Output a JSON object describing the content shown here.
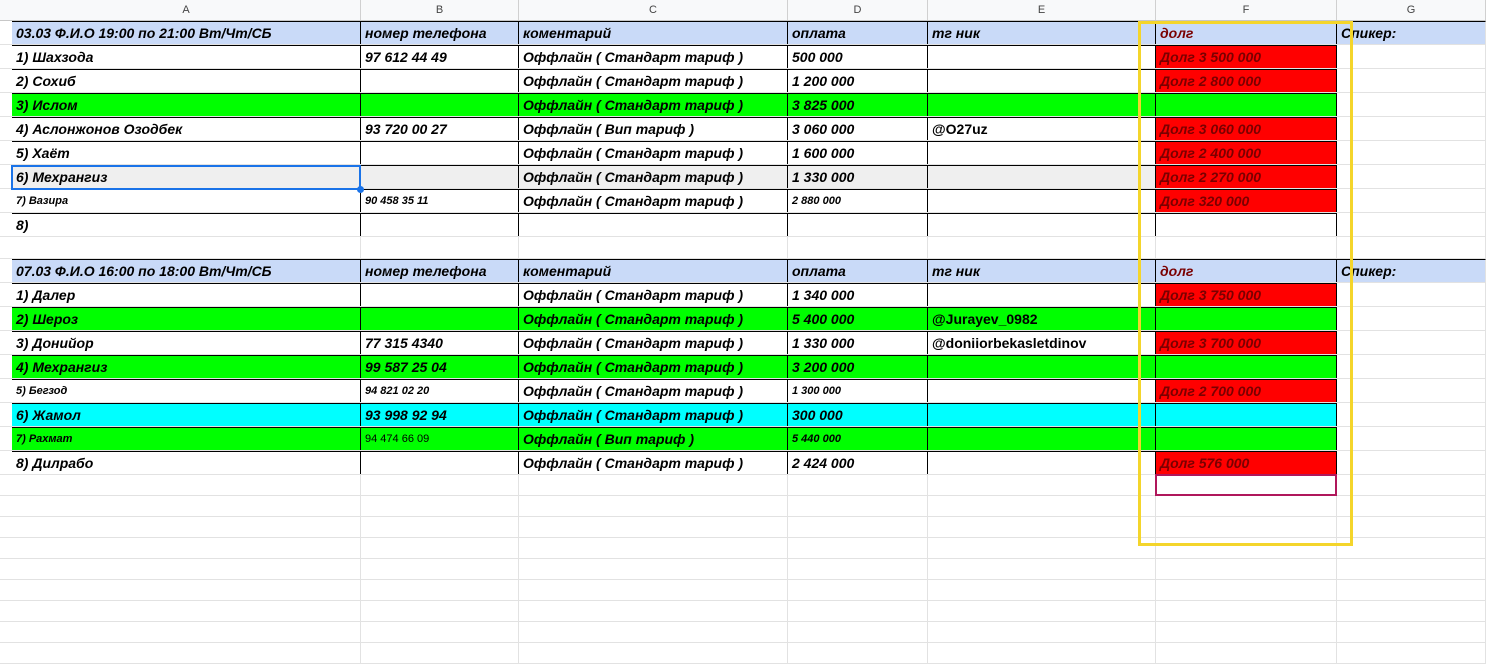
{
  "columns": [
    "A",
    "B",
    "C",
    "D",
    "E",
    "F",
    "G"
  ],
  "colors": {
    "header": "#c9daf8",
    "green": "#00ff00",
    "red": "#ff0000",
    "cyan": "#00ffff",
    "selected": "#efefef",
    "highlight_box": "#f4d52b",
    "selection": "#1a73e8"
  },
  "section1": {
    "header": [
      "03.03  Ф.И.О 19:00 по 21:00 Вт/Чт/СБ",
      "номер телефона",
      "коментарий",
      "оплата",
      "тг ник",
      "долг",
      "Спикер:"
    ],
    "rows": [
      {
        "fill": "",
        "cells": [
          "1) Шахзода",
          "97 612 44 49",
          "Оффлайн ( Стандарт тариф )",
          "500 000",
          "",
          "Долг 3 500 000",
          ""
        ],
        "debt_fill": "red"
      },
      {
        "fill": "",
        "cells": [
          "2) Сохиб",
          "",
          "Оффлайн ( Стандарт тариф )",
          "1 200 000",
          "",
          "Долг 2 800 000",
          ""
        ],
        "debt_fill": "red"
      },
      {
        "fill": "green",
        "cells": [
          "3) Ислом",
          "",
          "Оффлайн ( Стандарт тариф )",
          "3 825 000",
          "",
          "",
          ""
        ],
        "debt_fill": "green"
      },
      {
        "fill": "",
        "cells": [
          "4) Аслонжонов Озодбек",
          "93 720 00 27",
          "Оффлайн ( Вип тариф )",
          "3 060 000",
          "@O27uz",
          "Долг 3 060 000",
          ""
        ],
        "debt_fill": "red"
      },
      {
        "fill": "",
        "cells": [
          "5) Хаёт",
          "",
          "Оффлайн ( Стандарт тариф )",
          "1 600 000",
          "",
          "Долг 2 400 000",
          ""
        ],
        "debt_fill": "red"
      },
      {
        "fill": "selected",
        "cells": [
          "6) Мехрангиз",
          "",
          "Оффлайн ( Стандарт тариф )",
          "1 330 000",
          "",
          "Долг 2 270 000",
          ""
        ],
        "debt_fill": "red"
      },
      {
        "fill": "",
        "small": true,
        "cells": [
          "7) Вазира",
          "90 458 35 11",
          "Оффлайн ( Стандарт тариф )",
          "2 880 000",
          "",
          "Долг 320 000",
          ""
        ],
        "debt_fill": "red"
      },
      {
        "fill": "",
        "cells": [
          "8)",
          "",
          "",
          "",
          "",
          "",
          ""
        ],
        "debt_fill": ""
      }
    ]
  },
  "section2": {
    "header": [
      "07.03  Ф.И.О 16:00 по 18:00 Вт/Чт/СБ",
      "номер телефона",
      "коментарий",
      "оплата",
      "тг ник",
      "долг",
      "Спикер:"
    ],
    "rows": [
      {
        "fill": "",
        "cells": [
          "1) Далер",
          "",
          "Оффлайн ( Стандарт тариф )",
          "1 340 000",
          "",
          "Долг 3 750 000",
          ""
        ],
        "debt_fill": "red"
      },
      {
        "fill": "green",
        "cells": [
          "2) Шероз",
          "",
          "Оффлайн ( Стандарт тариф )",
          "5 400 000",
          "@Jurayev_0982",
          "",
          ""
        ],
        "debt_fill": "green"
      },
      {
        "fill": "",
        "cells": [
          "3) Донийор",
          "77 315 4340",
          "Оффлайн ( Стандарт тариф )",
          "1 330 000",
          "@doniiorbekasletdinov",
          "Долг 3 700 000",
          ""
        ],
        "debt_fill": "red"
      },
      {
        "fill": "green",
        "cells": [
          "4) Мехрангиз",
          "99 587 25 04",
          "Оффлайн ( Стандарт тариф )",
          "3 200 000",
          "",
          "",
          ""
        ],
        "debt_fill": "green"
      },
      {
        "fill": "",
        "small": true,
        "cells": [
          "5) Бегзод",
          "94 821 02 20",
          "Оффлайн ( Стандарт тариф )",
          "1 300 000",
          "",
          "Долг 2 700 000",
          ""
        ],
        "debt_fill": "red"
      },
      {
        "fill": "cyan",
        "cells": [
          "6) Жамол",
          "93 998 92 94",
          "Оффлайн ( Стандарт тариф )",
          "300 000",
          "",
          "",
          ""
        ],
        "debt_fill": "cyan"
      },
      {
        "fill": "green",
        "small": true,
        "cells": [
          "7) Рахмат",
          "94 474 66 09",
          "Оффлайн ( Вип тариф )",
          "5 440 000",
          "",
          "",
          ""
        ],
        "debt_fill": "green"
      },
      {
        "fill": "",
        "cells": [
          "8) Дилрабо",
          "",
          "Оффлайн ( Стандарт тариф )",
          "2 424 000",
          "",
          "Долг 576 000",
          ""
        ],
        "debt_fill": "red"
      }
    ]
  }
}
